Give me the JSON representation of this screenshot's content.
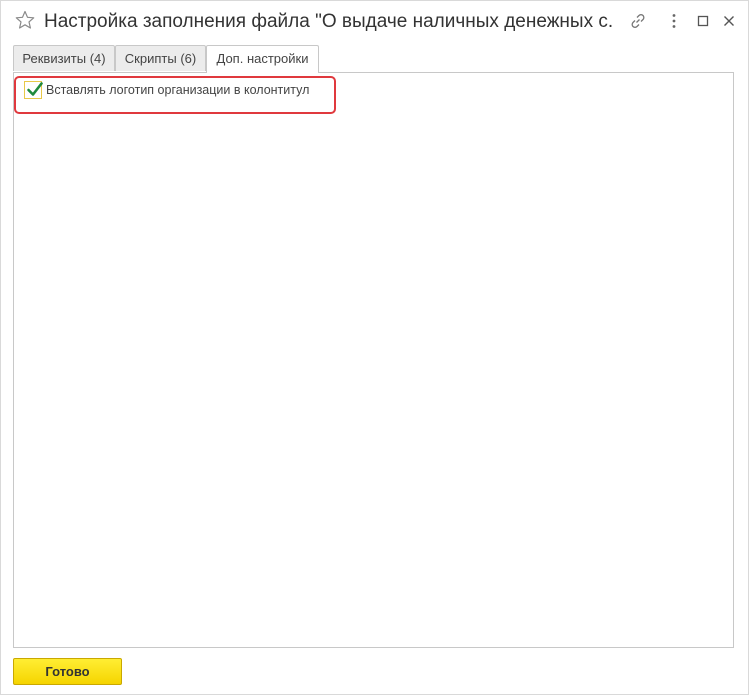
{
  "window": {
    "title": "Настройка заполнения файла \"О выдаче наличных денежных с..."
  },
  "icons": {
    "favorite": "star-icon",
    "link": "link-icon",
    "more": "more-vertical-icon",
    "maximize": "maximize-icon",
    "close": "close-icon"
  },
  "tabs": [
    {
      "label": "Реквизиты (4)"
    },
    {
      "label": "Скрипты (6)"
    },
    {
      "label": "Доп. настройки"
    }
  ],
  "panel": {
    "checkbox": {
      "label": "Вставлять логотип организации в колонтитул",
      "checked": true
    }
  },
  "footer": {
    "ok_label": "Готово"
  },
  "colors": {
    "highlight": "#e0393e",
    "checkmark": "#1f8a3c",
    "button": "#f5d400"
  }
}
